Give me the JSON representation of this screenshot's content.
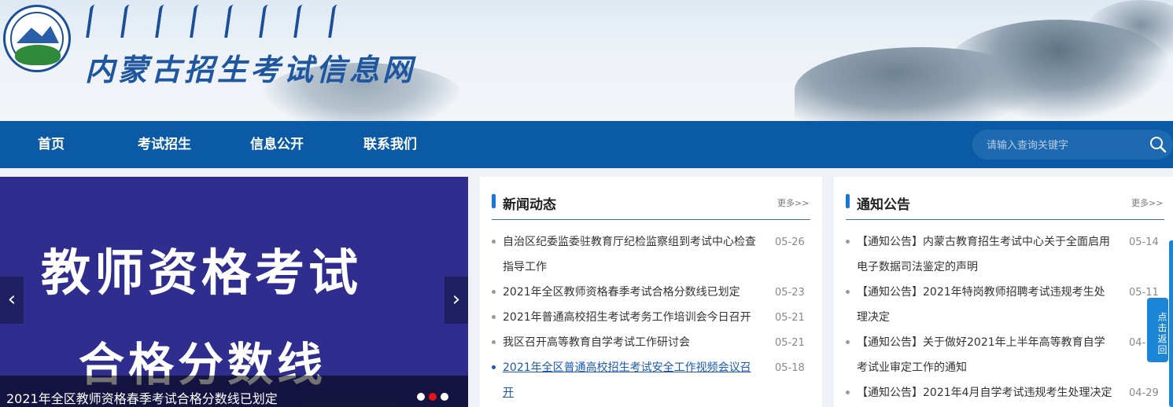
{
  "header": {
    "title": "内蒙古招生考试信息网",
    "logo_icon": "education-exam-emblem-icon"
  },
  "nav": {
    "items": [
      {
        "label": "首页"
      },
      {
        "label": "考试招生"
      },
      {
        "label": "信息公开"
      },
      {
        "label": "联系我们"
      }
    ],
    "search_placeholder": "请输入查询关键字",
    "search_icon": "search-icon"
  },
  "slider": {
    "slide_title_line1": "教师资格考试",
    "slide_title_line2": "合格分数线",
    "caption": "2021年全区教师资格春季考试合格分数线已划定",
    "prev_symbol": "‹",
    "next_symbol": "›",
    "dot_count": 3,
    "active_dot": 2
  },
  "news": {
    "title": "新闻动态",
    "more": "更多>>",
    "items": [
      {
        "lines": [
          "自治区纪委监委驻教育厅纪检监察组到考试中心检查",
          "指导工作"
        ],
        "date": "05-26",
        "hover": false
      },
      {
        "lines": [
          "2021年全区教师资格春季考试合格分数线已划定"
        ],
        "date": "05-23",
        "hover": false
      },
      {
        "lines": [
          "2021年普通高校招生考试考务工作培训会今日召开"
        ],
        "date": "05-21",
        "hover": false
      },
      {
        "lines": [
          "我区召开高等教育自学考试工作研讨会"
        ],
        "date": "05-21",
        "hover": false
      },
      {
        "lines": [
          "2021年全区普通高校招生考试安全工作视频会议召",
          "开"
        ],
        "date": "05-18",
        "hover": true
      }
    ]
  },
  "notice": {
    "title": "通知公告",
    "more": "更多>>",
    "items": [
      {
        "lines": [
          "【通知公告】内蒙古教育招生考试中心关于全面启用",
          "电子数据司法鉴定的声明"
        ],
        "date": "05-14"
      },
      {
        "lines": [
          "【通知公告】2021年特岗教师招聘考试违规考生处",
          "理决定"
        ],
        "date": "05-11"
      },
      {
        "lines": [
          "【通知公告】关于做好2021年上半年高等教育自学",
          "考试业审定工作的通知"
        ],
        "date": "04-"
      },
      {
        "lines": [
          "【通知公告】2021年4月自学考试违规考生处理决定"
        ],
        "date": "04-29"
      }
    ]
  },
  "back_to_top": {
    "label": "点击返回"
  },
  "colors": {
    "nav_bg": "#0b5aa6",
    "accent": "#1677d8",
    "slide_bg": "#2f2e8f",
    "active_dot": "#e4141b"
  }
}
